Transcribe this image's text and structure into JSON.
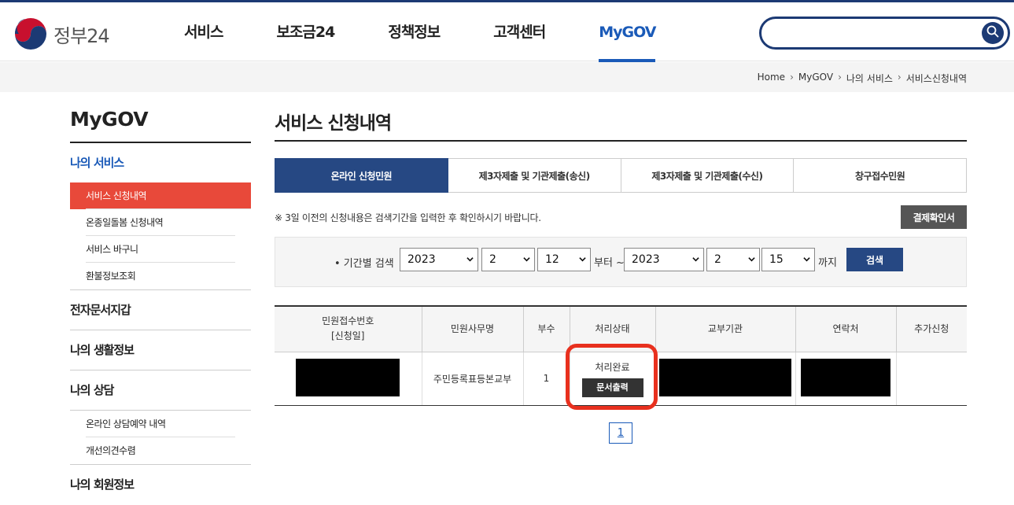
{
  "brand": {
    "logo_text": "정부24"
  },
  "gnb": {
    "items": [
      {
        "label": "서비스"
      },
      {
        "label": "보조금24"
      },
      {
        "label": "정책정보"
      },
      {
        "label": "고객센터"
      },
      {
        "label": "MyGOV"
      }
    ],
    "active_index": 4,
    "accent_color": "#1a5ab8"
  },
  "search": {
    "value": "",
    "placeholder": ""
  },
  "breadcrumb": [
    "Home",
    "MyGOV",
    "나의 서비스",
    "서비스신청내역"
  ],
  "sidebar": {
    "title": "MyGOV",
    "groups": [
      {
        "label": "나의 서비스",
        "items": [
          "서비스 신청내역",
          "온종일돌봄 신청내역",
          "서비스 바구니",
          "환불정보조회"
        ]
      },
      {
        "label": "전자문서지갑"
      },
      {
        "label": "나의 생활정보"
      },
      {
        "label": "나의 상담",
        "items": [
          "온라인 상담예약 내역",
          "개선의견수렴"
        ]
      },
      {
        "label": "나의 회원정보"
      }
    ]
  },
  "main": {
    "title": "서비스 신청내역",
    "tabs": [
      "온라인 신청민원",
      "제3자제출 및 기관제출(송신)",
      "제3자제출 및 기관제출(수신)",
      "창구접수민원"
    ],
    "active_tab": 0,
    "notice": "※ 3일 이전의 신청내용은 검색기간을 입력한 후 확인하시기 바랍니다.",
    "confirm_button": "결제확인서",
    "period": {
      "label": "• 기간별 검색",
      "from": {
        "year": "2023",
        "month": "2",
        "day": "12"
      },
      "from_suffix": "부터 ~",
      "to": {
        "year": "2023",
        "month": "2",
        "day": "15"
      },
      "to_suffix": "까지",
      "search_button": "검색"
    },
    "table": {
      "headers": [
        "민원접수번호",
        "[신청일]",
        "민원사무명",
        "부수",
        "처리상태",
        "교부기관",
        "연락처",
        "추가신청"
      ],
      "rows": [
        {
          "service_name": "주민등록표등본교부",
          "copies": "1",
          "status": "처리완료",
          "print_button": "문서출력"
        }
      ]
    },
    "pagination": {
      "current": "1"
    }
  },
  "colors": {
    "header_line": "#1c3a74",
    "tab_active": "#264883",
    "sidebar_active": "#e8493a",
    "highlight": "#e8301e"
  }
}
